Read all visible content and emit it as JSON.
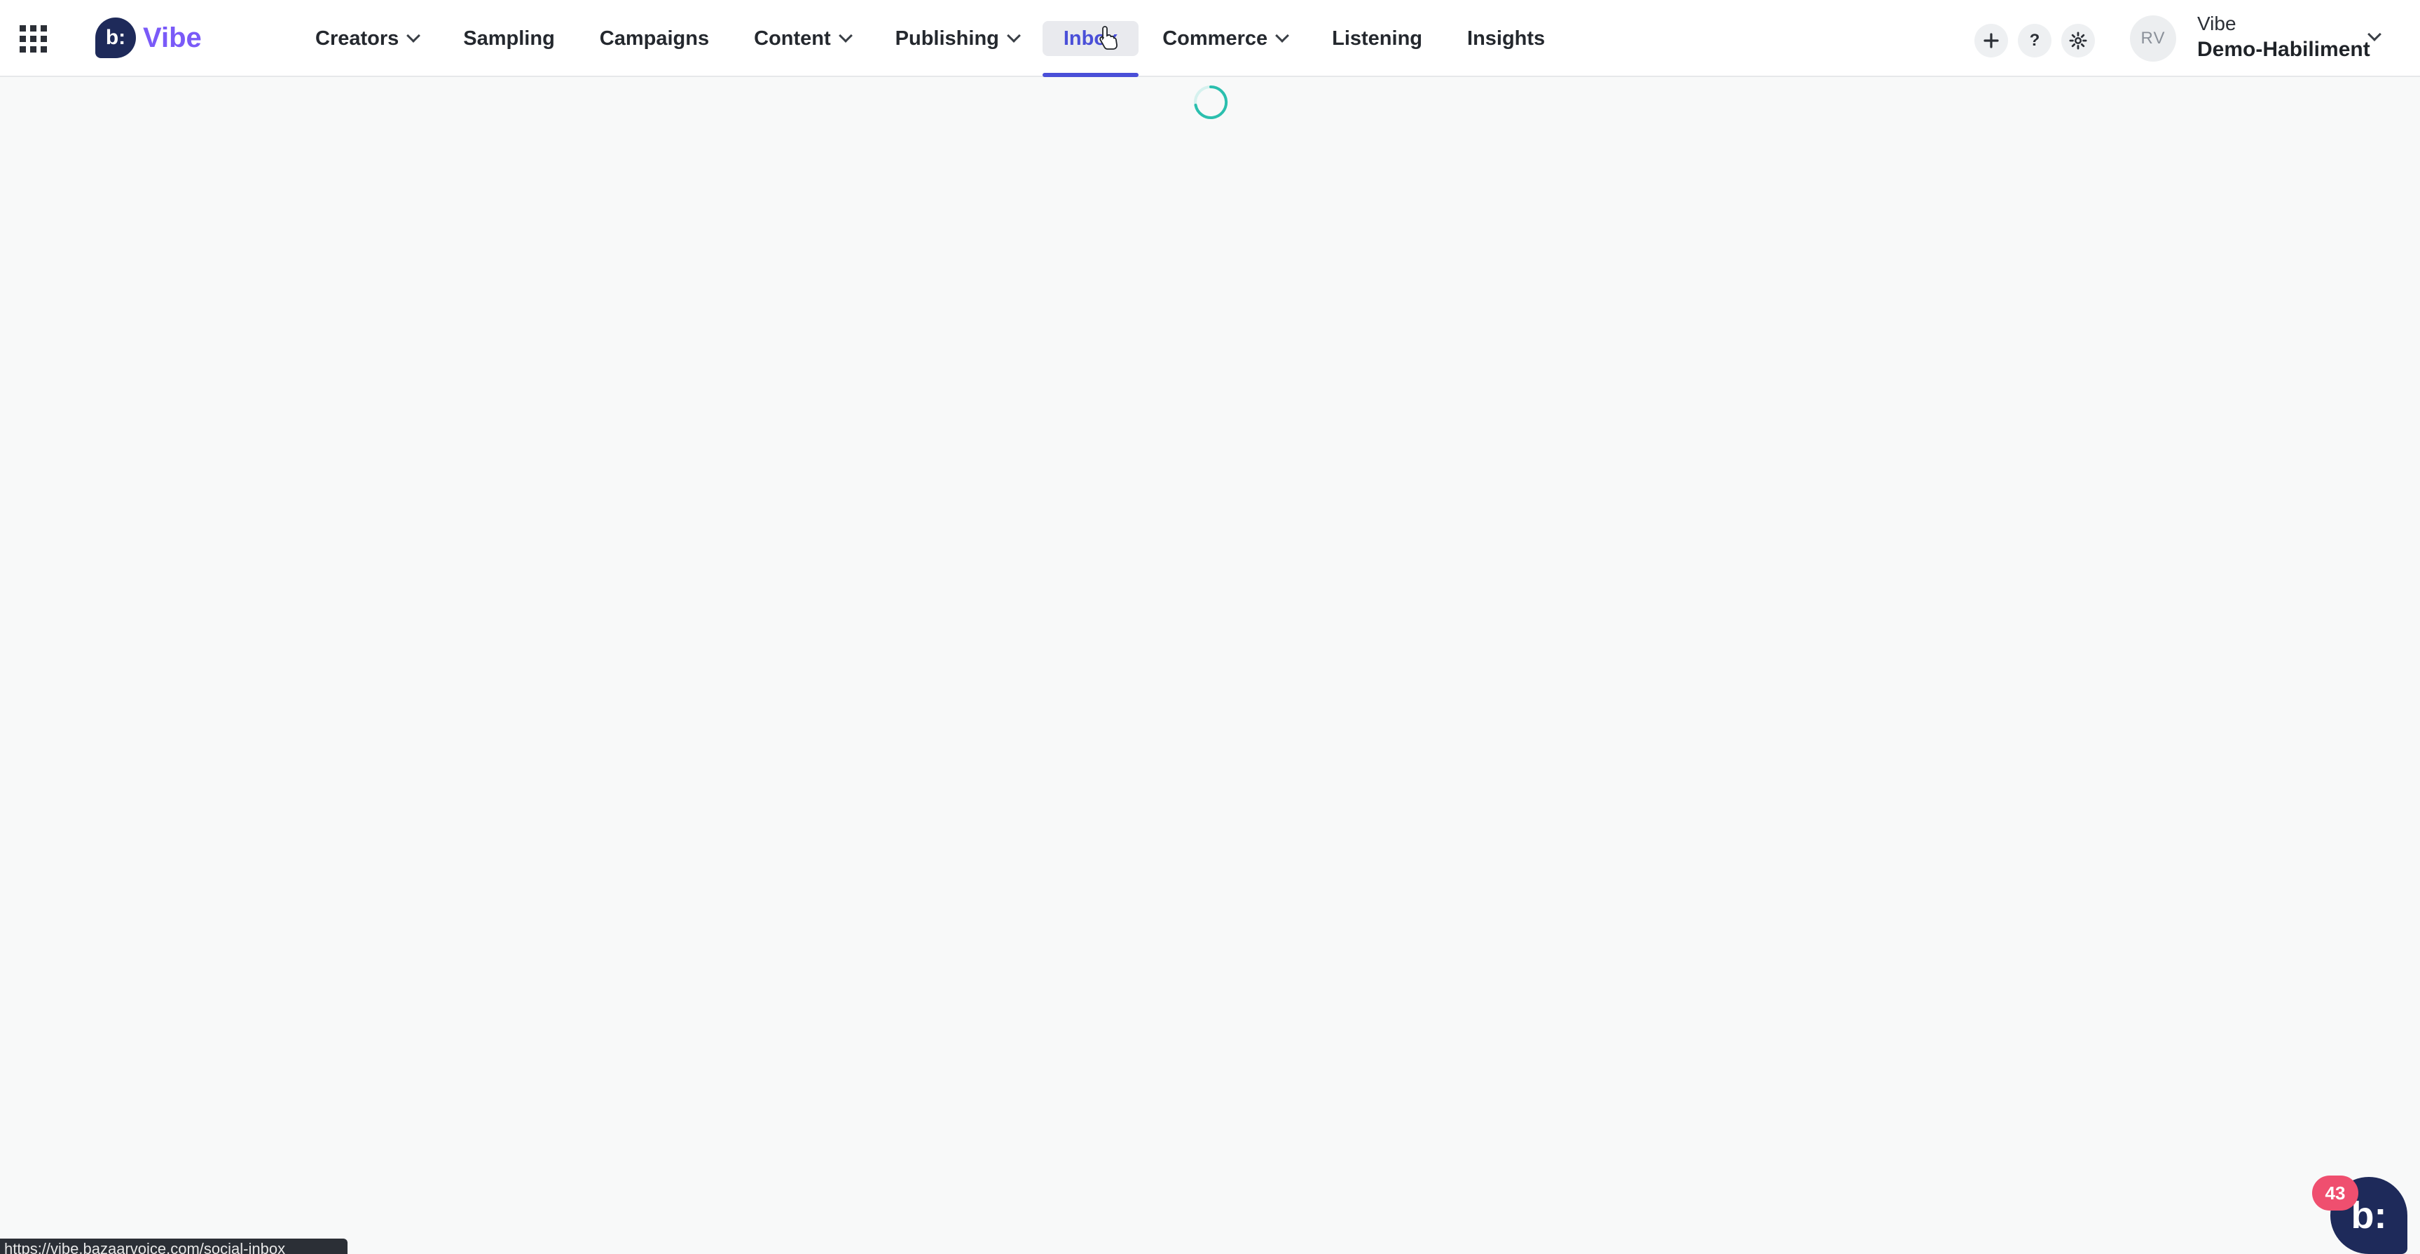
{
  "app": {
    "logo_text": "Vibe",
    "logo_mark": "b:",
    "brand_color": "#7a5af8"
  },
  "nav": {
    "items": [
      {
        "label": "Creators",
        "has_dropdown": true
      },
      {
        "label": "Sampling",
        "has_dropdown": false
      },
      {
        "label": "Campaigns",
        "has_dropdown": false
      },
      {
        "label": "Content",
        "has_dropdown": true
      },
      {
        "label": "Publishing",
        "has_dropdown": true
      },
      {
        "label": "Inbox",
        "has_dropdown": false,
        "active": true
      },
      {
        "label": "Commerce",
        "has_dropdown": true
      },
      {
        "label": "Listening",
        "has_dropdown": false
      },
      {
        "label": "Insights",
        "has_dropdown": false
      }
    ],
    "active_color": "#4a4fd8"
  },
  "toolbar": {
    "add_icon": "plus-icon",
    "help_label": "?",
    "settings_icon": "gear-icon"
  },
  "account": {
    "avatar_initials": "RV",
    "org": "Vibe",
    "name": "Demo-Habiliment"
  },
  "status_bar": {
    "url": "https://vibe.bazaarvoice.com/social-inbox"
  },
  "chat": {
    "badge_count": "43",
    "fab_mark": "b:"
  }
}
